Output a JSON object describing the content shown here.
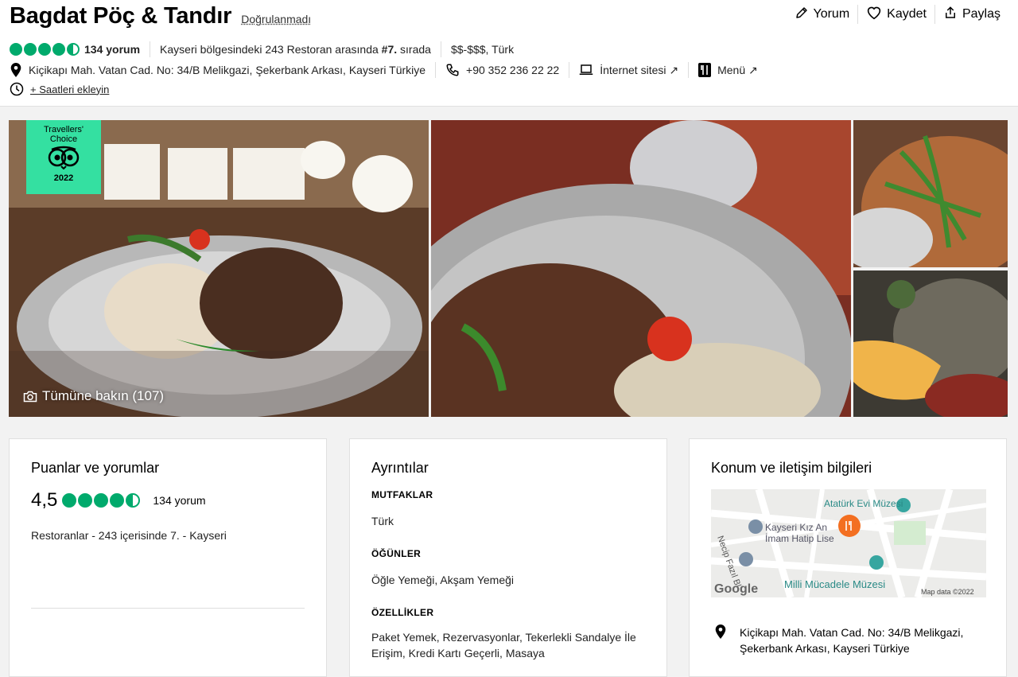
{
  "header": {
    "title": "Bagdat Pöç & Tandır",
    "unverified": "Doğrulanmadı",
    "actions": [
      {
        "label": "Yorum",
        "icon": "pencil-icon"
      },
      {
        "label": "Kaydet",
        "icon": "heart-icon"
      },
      {
        "label": "Paylaş",
        "icon": "share-icon"
      }
    ],
    "rating_value": 4.5,
    "reviews": "134 yorum",
    "rank_prefix": "Kayseri bölgesindeki 243 Restoran arasında ",
    "rank_bold": "#7.",
    "rank_suffix": " sırada",
    "price_cuisine": "$$-$$$, Türk",
    "address": "Kiçikapı Mah. Vatan Cad. No: 34/B Melikgazi, Şekerbank Arkası, Kayseri Türkiye",
    "phone": "+90 352 236 22 22",
    "website": "İnternet sitesi ↗",
    "menu": "Menü ↗",
    "add_hours": "+ Saatleri ekleyin"
  },
  "gallery": {
    "badge_line1": "Travellers'",
    "badge_line2": "Choice",
    "badge_year": "2022",
    "see_all": "Tümüne bakın (107)"
  },
  "ratings_card": {
    "title": "Puanlar ve yorumlar",
    "score": "4,5",
    "reviews": "134 yorum",
    "rank": "Restoranlar - 243 içerisinde 7. - Kayseri"
  },
  "details_card": {
    "title": "Ayrıntılar",
    "cuisines_label": "MUTFAKLAR",
    "cuisines_value": "Türk",
    "meals_label": "ÖĞÜNLER",
    "meals_value": "Öğle Yemeği, Akşam Yemeği",
    "features_label": "ÖZELLİKLER",
    "features_value": "Paket Yemek, Rezervasyonlar, Tekerlekli Sandalye İle Erişim, Kredi Kartı Geçerli, Masaya"
  },
  "location_card": {
    "title": "Konum ve iletişim bilgileri",
    "map_labels": {
      "ataturk": "Atatürk Evi Müzesi",
      "kiz": "Kayseri Kız An",
      "imam": "İmam Hatip Lise",
      "necip": "Necip Fazıl Bl",
      "milli": "Milli Mücadele Müzesi",
      "google": "Google",
      "mapdata": "Map data ©2022"
    },
    "address": "Kiçikapı Mah. Vatan Cad. No: 34/B Melikgazi, Şekerbank Arkası, Kayseri Türkiye"
  },
  "colors": {
    "bubble": "#00aa6c",
    "badge": "#34e0a1",
    "map_pin": "#f36f21"
  }
}
